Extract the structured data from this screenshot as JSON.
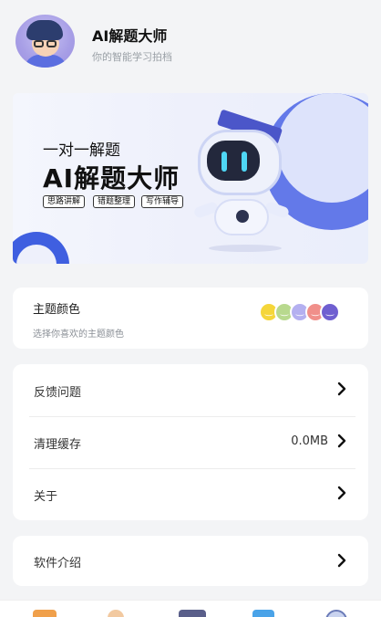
{
  "header": {
    "app_title": "AI解题大师",
    "app_subtitle": "你的智能学习拍档"
  },
  "banner": {
    "line1": "一对一解题",
    "line2": "AI解题大师",
    "tags": [
      "思路讲解",
      "错题整理",
      "写作辅导"
    ]
  },
  "theme": {
    "title": "主题颜色",
    "subtitle": "选择你喜欢的主题颜色",
    "swatches": [
      "#f5d63a",
      "#b8d98e",
      "#b4b0f0",
      "#f08f8a",
      "#6f5fd0"
    ]
  },
  "menu": {
    "items": [
      {
        "label": "反馈问题",
        "value": ""
      },
      {
        "label": "清理缓存",
        "value": "0.0MB"
      },
      {
        "label": "关于",
        "value": ""
      }
    ]
  },
  "intro": {
    "label": "软件介绍"
  },
  "tabbar": {
    "icons": [
      "gift-icon",
      "person-icon",
      "hat-icon",
      "book-icon",
      "search-icon"
    ]
  }
}
